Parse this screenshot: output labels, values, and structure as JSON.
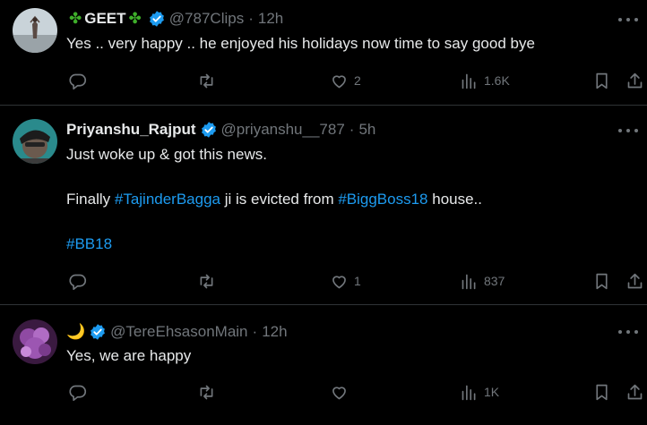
{
  "tweets": [
    {
      "display_name": "GEET",
      "name_emoji": "✤",
      "handle": "@787Clips",
      "time": "12h",
      "text": "Yes .. very happy .. he enjoyed his holidays now time to say good bye",
      "stats": {
        "replies": "",
        "retweets": "",
        "likes": "2",
        "views": "1.6K"
      }
    },
    {
      "display_name": "Priyanshu_Rajput",
      "handle": "@priyanshu__787",
      "time": "5h",
      "line1": "Just woke up & got this news.",
      "line2_a": "Finally ",
      "line2_tag1": "#TajinderBagga",
      "line2_b": " ji is evicted from ",
      "line2_tag2": "#BiggBoss18",
      "line2_c": " house..",
      "line3_tag": "#BB18",
      "stats": {
        "replies": "",
        "retweets": "",
        "likes": "1",
        "views": "837"
      }
    },
    {
      "display_name": "🌙",
      "handle": "@TereEhsasonMain",
      "time": "12h",
      "text": "Yes, we are happy",
      "stats": {
        "replies": "",
        "retweets": "",
        "likes": "",
        "views": "1K"
      }
    }
  ],
  "separator": "·",
  "icons": {
    "reply": "reply-icon",
    "retweet": "retweet-icon",
    "like": "heart-icon",
    "views": "views-icon",
    "bookmark": "bookmark-icon",
    "share": "share-icon",
    "verified": "verified-badge-icon",
    "more": "more-icon"
  },
  "colors": {
    "background": "#000000",
    "text": "#e7e9ea",
    "muted": "#71767b",
    "link": "#1d9bf0",
    "verified": "#1d9bf0",
    "clover": "#3eae2a"
  }
}
